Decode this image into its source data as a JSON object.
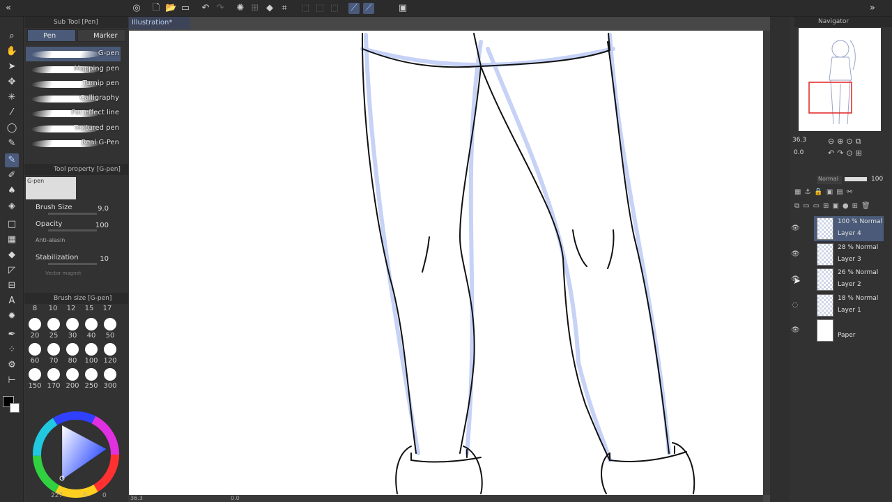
{
  "doc_tab": "Illustration*",
  "subtool": {
    "title": "Sub Tool [Pen]",
    "tabs": [
      "Pen",
      "Marker"
    ],
    "brushes": [
      "G-pen",
      "Mapping pen",
      "Turnip pen",
      "Calligraphy",
      "For effect line",
      "Textured pen",
      "Real G-Pen"
    ]
  },
  "toolprop": {
    "title": "Tool property [G-pen]",
    "preset": "G-pen",
    "brush_size_label": "Brush Size",
    "brush_size": "9.0",
    "opacity_label": "Opacity",
    "opacity": "100",
    "aa_label": "Anti-alasin",
    "stab_label": "Stabilization",
    "stab": "10",
    "vector_label": "Vector magnet"
  },
  "brushsize": {
    "title": "Brush size [G-pen]",
    "header": [
      "8",
      "10",
      "12",
      "15",
      "17"
    ],
    "rows": [
      [
        "20",
        "25",
        "30",
        "40",
        "50"
      ],
      [
        "60",
        "70",
        "80",
        "100",
        "120"
      ],
      [
        "150",
        "170",
        "200",
        "250",
        "300"
      ]
    ]
  },
  "color": {
    "fg": "#000000",
    "bg": "#ffffff",
    "readout": "227",
    "readout2": "0",
    "readout3": "0"
  },
  "navigator": {
    "title": "Navigator",
    "zoom": "36.3",
    "angle": "0.0"
  },
  "layers": {
    "blend": "Normal",
    "opacity": "100",
    "items": [
      {
        "mode": "100 % Normal",
        "name": "Layer 4"
      },
      {
        "mode": "28 % Normal",
        "name": "Layer 3"
      },
      {
        "mode": "26 % Normal",
        "name": "Layer 2"
      },
      {
        "mode": "18 % Normal",
        "name": "Layer 1"
      },
      {
        "mode": "",
        "name": "Paper"
      }
    ]
  },
  "status": {
    "zoom": "36.3",
    "angle": "0.0"
  }
}
